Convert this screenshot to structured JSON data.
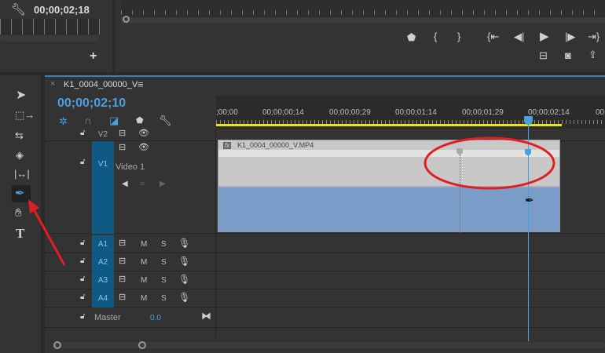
{
  "source_monitor": {
    "timecode": "00;00;02;18",
    "add_label": "+"
  },
  "program_monitor": {
    "buttons": [
      "add-marker",
      "mark-in",
      "mark-out",
      "go-to-in",
      "step-back",
      "play",
      "step-forward",
      "go-to-out",
      "vr-video",
      "export-frame",
      "export"
    ]
  },
  "timeline": {
    "tab_close": "×",
    "sequence_name": "K1_0004_00000_V",
    "tab_menu": "≡",
    "timecode": "00;00;02;10",
    "ruler_labels": [
      ";00;00",
      "00;00;00;14",
      "00;00;00;29",
      "00;00;01;14",
      "00;00;01;29",
      "00;00;02;14",
      "00;"
    ],
    "video_tracks": [
      {
        "label": "V2"
      },
      {
        "label": "V1",
        "name": "Video 1"
      }
    ],
    "audio_tracks": [
      {
        "label": "A1"
      },
      {
        "label": "A2"
      },
      {
        "label": "A3"
      },
      {
        "label": "A4"
      }
    ],
    "mute": "M",
    "solo": "S",
    "master": {
      "label": "Master",
      "value": "0.0"
    },
    "clip": {
      "fx": "fx",
      "name": "K1_0004_00000_V.MP4"
    }
  },
  "colors": {
    "accent": "#4a9fe0",
    "track_label": "#0f5a85",
    "clip_video": "#c8c8c8",
    "clip_audio": "#7a9cc8",
    "annotation": "#e02020",
    "work_area": "#e6e619"
  }
}
